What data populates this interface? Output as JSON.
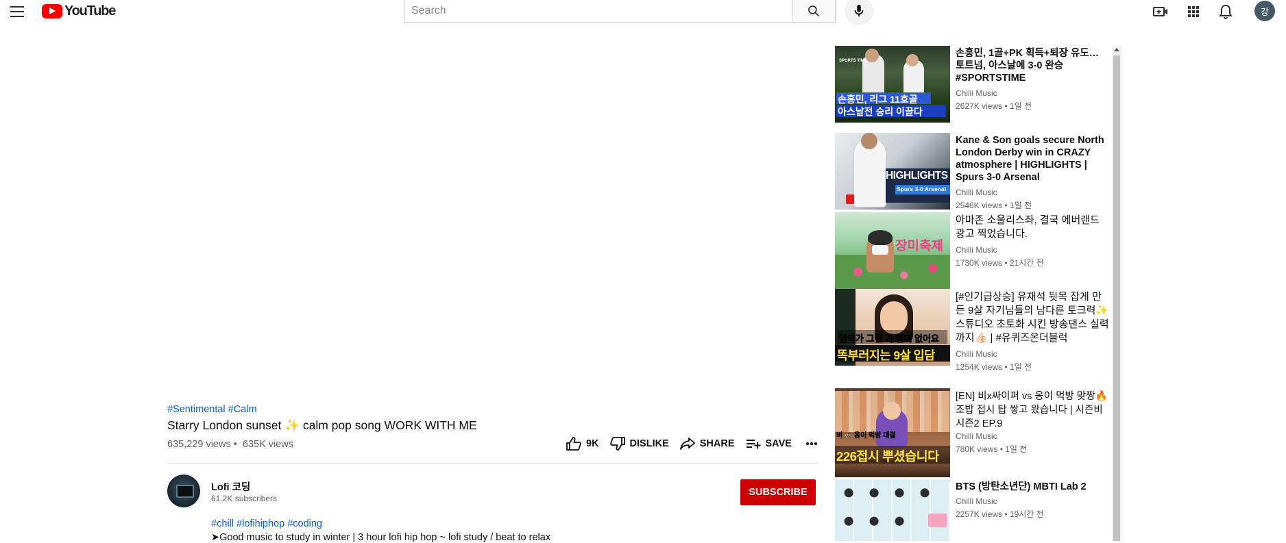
{
  "header": {
    "logo_text": "YouTube",
    "search_placeholder": "Search",
    "avatar_letter": "강"
  },
  "video": {
    "hashtags": [
      "#Sentimental",
      "#Calm"
    ],
    "title": "Starry London sunset ✨ calm pop song WORK WITH ME",
    "views": "635,229 views",
    "views_short": "635K views",
    "likes": "9K",
    "dislike_label": "DISLIKE",
    "share_label": "SHARE",
    "save_label": "SAVE"
  },
  "channel": {
    "name": "Lofi 코딩",
    "subscribers": "61.2K subscribers",
    "subscribe_label": "SUBSCRIBE"
  },
  "description": {
    "tags": [
      "#chill",
      "#lofihiphop",
      "#coding"
    ],
    "first_line": "➤Good music to study in winter | 3 hour lofi hip hop ~ lofi study / beat to relax"
  },
  "sidebar": {
    "items": [
      {
        "title": "손흥민, 1골+PK 획득+퇴장 유도… 토트넘, 아스날에 3-0 완승 #SPORTSTIME",
        "channel": "Chilli Music",
        "views": "2627K views",
        "age": "1일 전",
        "thumb_text": [
          "SPORTS TIME",
          "손흥민, 리그 11호골",
          "아스날전 승리 이끌다"
        ]
      },
      {
        "title": "Kane & Son goals secure North London Derby win in CRAZY atmosphere | HIGHLIGHTS | Spurs 3-0 Arsenal",
        "channel": "Chilli Music",
        "views": "2546K views",
        "age": "1일 전",
        "thumb_text": [
          "HIGHLIGHTS",
          "Spurs 3-0 Arsenal"
        ]
      },
      {
        "title": "아마존 소울리스좌, 결국 에버랜드 광고 찍었습니다.",
        "channel": "Chilli Music",
        "views": "1730K views",
        "age": "21시간 전",
        "thumb_text": [
          "장미축제"
        ]
      },
      {
        "title": "[#인기급상승] 유재석 뒷목 잡게 만든 9살 자기님들의 남다른 토크력✨ 스튜디오 초토화 시킨 방송댄스 실력까지👍🏻 | #유퀴즈온더블럭",
        "channel": "Chilli Music",
        "views": "1254K views",
        "age": "1일 전",
        "thumb_text": [
          "엄마가 그런 거 절대 없어요",
          "똑부러지는 9살 입담"
        ]
      },
      {
        "title": "[EN] 비x싸이퍼 vs 옹이 먹방 맞짱🔥 조밥 접시 탑 쌓고 왔습니다 | 시즌비시즌2 EP.9",
        "channel": "Chilli Music",
        "views": "780K views",
        "age": "1일 전",
        "thumb_text": [
          "비 vs 옹이 먹방 대결",
          "226접시 뿌셨습니다"
        ]
      },
      {
        "title": "BTS (방탄소년단) MBTI Lab 2",
        "channel": "Chilli Music",
        "views": "2257K views",
        "age": "19시간 전",
        "thumb_text": []
      }
    ]
  },
  "colors": {
    "accent_link": "#065fd4",
    "subscribe_red": "#cc0000",
    "youtube_red": "#ff0000"
  }
}
